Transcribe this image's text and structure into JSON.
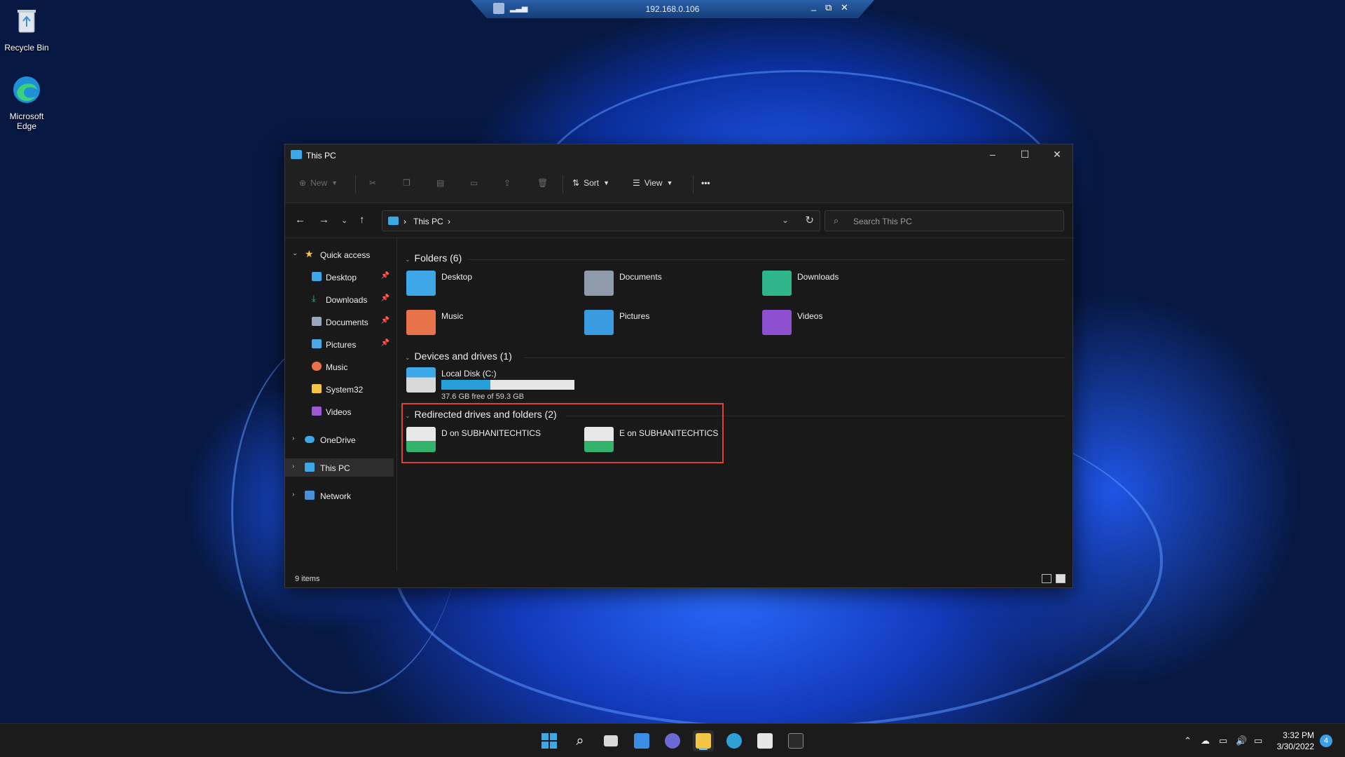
{
  "desktop": {
    "icons": [
      {
        "label": "Recycle Bin",
        "icon": "recycle-bin-icon"
      },
      {
        "label": "Microsoft Edge",
        "icon": "edge-icon"
      }
    ]
  },
  "rdp_bar": {
    "host": "192.168.0.106",
    "minimize": "_",
    "restore": "⧉",
    "close": "✕"
  },
  "window": {
    "title": "This PC",
    "minimize": "–",
    "maximize": "☐",
    "close": "✕"
  },
  "commandbar": {
    "new_label": "New",
    "sort_label": "Sort",
    "view_label": "View",
    "more_label": "•••"
  },
  "address": {
    "crumb": "This PC",
    "search_placeholder": "Search This PC"
  },
  "sidebar": {
    "quick_access": "Quick access",
    "items": [
      {
        "label": "Desktop",
        "pinned": true,
        "color": "#3da7e8"
      },
      {
        "label": "Downloads",
        "pinned": true,
        "color": "#3bb58a"
      },
      {
        "label": "Documents",
        "pinned": true,
        "color": "#9aa7b8"
      },
      {
        "label": "Pictures",
        "pinned": true,
        "color": "#4aa8e8"
      },
      {
        "label": "Music",
        "pinned": false,
        "color": "#e8734a"
      },
      {
        "label": "System32",
        "pinned": false,
        "color": "#f4c542"
      },
      {
        "label": "Videos",
        "pinned": false,
        "color": "#9b59d6"
      }
    ],
    "onedrive": "OneDrive",
    "this_pc": "This PC",
    "network": "Network",
    "pin_glyph": "📌"
  },
  "content": {
    "folders_header": "Folders (6)",
    "folders": [
      {
        "name": "Desktop",
        "color": "#3da7e8"
      },
      {
        "name": "Documents",
        "color": "#8f9bab"
      },
      {
        "name": "Downloads",
        "color": "#2fb58a"
      },
      {
        "name": "Music",
        "color": "#e8734a"
      },
      {
        "name": "Pictures",
        "color": "#3a9be0"
      },
      {
        "name": "Videos",
        "color": "#8e4fd0"
      }
    ],
    "drives_header": "Devices and drives (1)",
    "drive": {
      "name": "Local Disk (C:)",
      "free_text": "37.6 GB free of 59.3 GB",
      "used_fraction": 0.366
    },
    "redirected_header": "Redirected drives and folders (2)",
    "redirected": [
      {
        "name": "D on SUBHANITECHTICS"
      },
      {
        "name": "E on SUBHANITECHTICS"
      }
    ]
  },
  "status": {
    "count": "9 items"
  },
  "taskbar": {
    "apps": [
      {
        "name": "start",
        "color": "#3da7e8"
      },
      {
        "name": "search",
        "color": "#ffffff"
      },
      {
        "name": "task-view",
        "color": "#d8d8d8"
      },
      {
        "name": "widgets",
        "color": "#3a8ee6"
      },
      {
        "name": "chat",
        "color": "#6b69d6"
      },
      {
        "name": "file-explorer",
        "color": "#f4c542"
      },
      {
        "name": "edge",
        "color": "#2f9fd8"
      },
      {
        "name": "store",
        "color": "#e6e6e6"
      },
      {
        "name": "terminal",
        "color": "#2b2b2b"
      }
    ],
    "clock_time": "3:32 PM",
    "clock_date": "3/30/2022",
    "notifications": "4"
  }
}
